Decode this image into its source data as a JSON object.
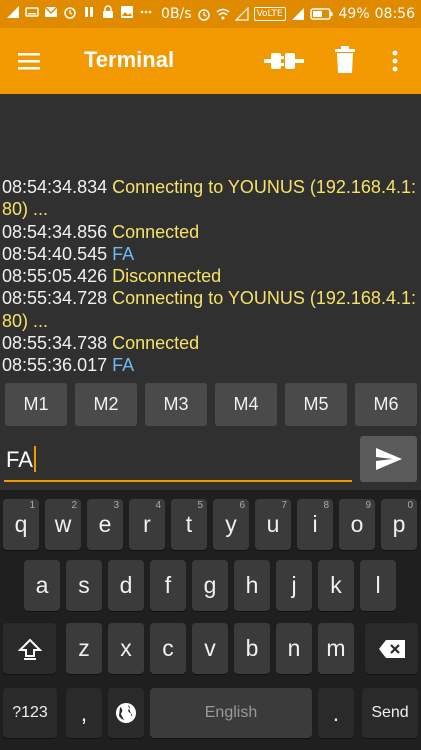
{
  "status_bar": {
    "speed": "0B/s",
    "battery": "49%",
    "time": "08:56",
    "volte": "VoLTE"
  },
  "app_bar": {
    "title": "Terminal"
  },
  "log": [
    {
      "time": "08:54:34.834",
      "text": "Connecting to YOUNUS (192.168.4.1:80) ...",
      "kind": "status"
    },
    {
      "time": "08:54:34.856",
      "text": "Connected",
      "kind": "status"
    },
    {
      "time": "08:54:40.545",
      "text": "FA",
      "kind": "rx"
    },
    {
      "time": "08:55:05.426",
      "text": "Disconnected",
      "kind": "status"
    },
    {
      "time": "08:55:34.728",
      "text": "Connecting to YOUNUS (192.168.4.1:80) ...",
      "kind": "status"
    },
    {
      "time": "08:55:34.738",
      "text": "Connected",
      "kind": "status"
    },
    {
      "time": "08:55:36.017",
      "text": "FA",
      "kind": "rx"
    }
  ],
  "macros": [
    "M1",
    "M2",
    "M3",
    "M4",
    "M5",
    "M6"
  ],
  "send": {
    "value": "FA"
  },
  "keyboard": {
    "row1": [
      {
        "k": "q",
        "h": "1"
      },
      {
        "k": "w",
        "h": "2"
      },
      {
        "k": "e",
        "h": "3"
      },
      {
        "k": "r",
        "h": "4"
      },
      {
        "k": "t",
        "h": "5"
      },
      {
        "k": "y",
        "h": "6"
      },
      {
        "k": "u",
        "h": "7"
      },
      {
        "k": "i",
        "h": "8"
      },
      {
        "k": "o",
        "h": "9"
      },
      {
        "k": "p",
        "h": "0"
      }
    ],
    "row2": [
      "a",
      "s",
      "d",
      "f",
      "g",
      "h",
      "j",
      "k",
      "l"
    ],
    "row3": [
      "z",
      "x",
      "c",
      "v",
      "b",
      "n",
      "m"
    ],
    "symbols_label": "?123",
    "comma_label": ",",
    "space_label": "English",
    "period_label": ".",
    "send_label": "Send"
  },
  "colors": {
    "accent": "#f29800",
    "status_text": "#f6e267",
    "rx_text": "#6fb8f0"
  }
}
